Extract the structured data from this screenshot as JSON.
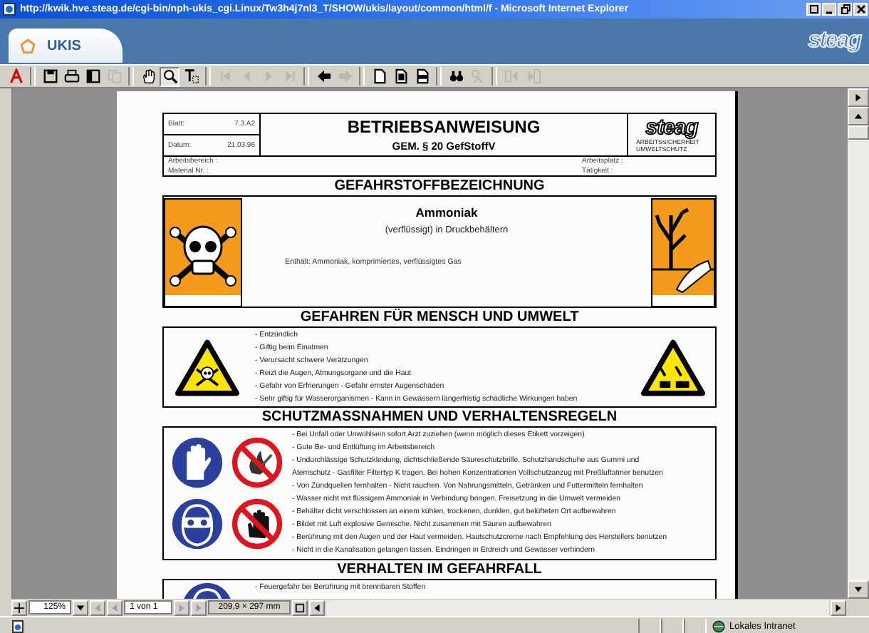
{
  "window": {
    "title": "http://kwik.hve.steag.de/cgi-bin/nph-ukis_cgi.Linux/Tw3h4j7nl3_T/SHOW/ukis/layout/common/html/f - Microsoft Internet Explorer"
  },
  "app_tab": {
    "label": "UKIS"
  },
  "brand": {
    "logo": "steag"
  },
  "toolbar": [
    {
      "kind": "acrobat",
      "disabled": false,
      "selected": false
    },
    {
      "kind": "save",
      "disabled": false,
      "selected": false
    },
    {
      "kind": "print",
      "disabled": false,
      "selected": false
    },
    {
      "kind": "panel",
      "disabled": false,
      "selected": false
    },
    {
      "kind": "copy",
      "disabled": true,
      "selected": false
    },
    {
      "kind": "hand",
      "disabled": false,
      "selected": false
    },
    {
      "kind": "zoom",
      "disabled": false,
      "selected": true
    },
    {
      "kind": "text",
      "disabled": false,
      "selected": false
    },
    {
      "kind": "first",
      "disabled": true,
      "selected": false
    },
    {
      "kind": "prev",
      "disabled": true,
      "selected": false
    },
    {
      "kind": "next",
      "disabled": true,
      "selected": false
    },
    {
      "kind": "last",
      "disabled": true,
      "selected": false
    },
    {
      "kind": "back",
      "disabled": false,
      "selected": false
    },
    {
      "kind": "forward",
      "disabled": true,
      "selected": false
    },
    {
      "kind": "page",
      "disabled": false,
      "selected": false
    },
    {
      "kind": "fit-page",
      "disabled": false,
      "selected": false
    },
    {
      "kind": "fit-width",
      "disabled": false,
      "selected": false
    },
    {
      "kind": "find",
      "disabled": false,
      "selected": false
    },
    {
      "kind": "find-web",
      "disabled": true,
      "selected": false
    },
    {
      "kind": "page-back",
      "disabled": true,
      "selected": false
    },
    {
      "kind": "page-forward",
      "disabled": true,
      "selected": false
    }
  ],
  "document": {
    "header": {
      "sheet_label": "Blatt:",
      "sheet": "7.3.A2",
      "date_label": "Datum:",
      "date": "21.03.96",
      "title": "BETRIEBSANWEISUNG",
      "subtitle": "GEM. § 20 GefStoffV",
      "logo": "steag",
      "logo_caption": "ARBEITSSICHERHEIT UMWELTSCHUTZ",
      "fields": [
        "Arbeitsbereich :",
        "Arbeitsplatz :",
        "Material Nr. :",
        "Tätigkeit :"
      ]
    },
    "sections": [
      {
        "kind": "substance",
        "heading": "GEFAHRSTOFFBEZEICHNUNG",
        "left_symbols": [
          {
            "kind": "toxic"
          }
        ],
        "right_symbols": [
          {
            "kind": "environment"
          }
        ],
        "name": "Ammoniak",
        "form": "(verflüssigt) in Druckbehältern",
        "contains": "Enthält: Ammoniak, komprimiertes, verflüssigtes Gas"
      },
      {
        "kind": "list",
        "heading": "GEFAHREN FÜR MENSCH UND UMWELT",
        "left_symbols": [
          {
            "kind": "toxic-triangle"
          }
        ],
        "right_symbols": [
          {
            "kind": "corrosive-triangle"
          }
        ],
        "lines": [
          "- Entzündlich",
          "- Giftig beim Einatmen",
          "- Verursacht schwere Verätzungen",
          "- Reizt die Augen, Atmungsorgane und die Haut",
          "- Gefahr von Erfrierungen - Gefahr ernster Augenschäden",
          "- Sehr giftig für Wasserorganismen - Kann in Gewässern längerfristig schädliche Wirkungen haben"
        ]
      },
      {
        "kind": "list",
        "heading": "SCHUTZMASSNAHMEN UND VERHALTENSREGELN",
        "left_symbols": [
          {
            "kind": "gloves"
          },
          {
            "kind": "no-fire"
          },
          {
            "kind": "goggles"
          },
          {
            "kind": "no-touch"
          }
        ],
        "lines": [
          "- Bei Unfall oder Unwohlsein sofort Arzt zuziehen (wenn möglich dieses Etikett vorzeigen)",
          "- Gute Be- und Entlüftung im Arbeitsbereich",
          "- Undurchlässige Schutzkleidung, dichtschließende Säureschutzbrille, Schutzhandschuhe aus Gummi und",
          "Atemschutz - Gasfilter Filtertyp K tragen. Bei hohen Konzentrationen Vollschutzanzug mit Preßluftatmer benutzen",
          "- Von Zündquellen fernhalten - Nicht rauchen. Von Nahrungsmitteln, Getränken und Futtermitteln fernhalten",
          "- Wasser nicht mit flüssigem Ammoniak in Verbindung bringen. Freisetzung in die Umwelt vermeiden",
          "- Behälter dicht verschlossen an einem kühlen, trockenen, dunklen, gut belüfteten Ort aufbewahren",
          "- Bildet mit Luft explosive Gemische. Nicht zusammen mit Säuren aufbewahren",
          "- Berührung mit den Augen und der Haut vermeiden. Hautschutzcreme nach Empfehlung des Herstellers benutzen",
          "- Nicht in die Kanalisation gelangen lassen. Eindringen in Erdreich und Gewässer verhindern"
        ]
      },
      {
        "kind": "list",
        "heading": "VERHALTEN IM GEFAHRFALL",
        "left_symbols": [
          {
            "kind": "goggles"
          }
        ],
        "lines": [
          "- Feuergefahr bei Berührung mit brennbaren Stoffen"
        ]
      }
    ]
  },
  "navigation": {
    "zoom": "125%",
    "page": "1 von 1",
    "page_size": "209,9 × 297 mm"
  },
  "status_bar": {
    "zone": "Lokales Intranet"
  }
}
